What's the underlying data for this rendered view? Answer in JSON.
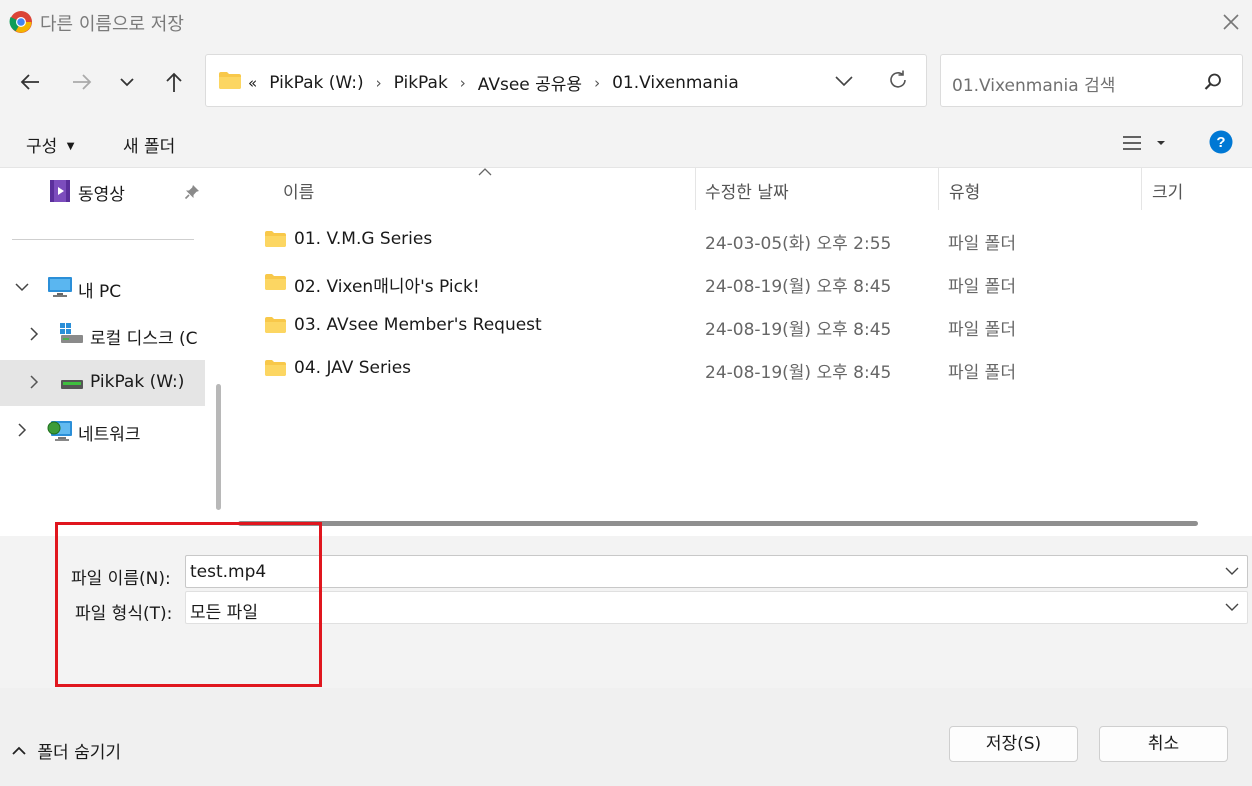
{
  "window": {
    "title": "다른 이름으로 저장",
    "close_icon": "close-icon"
  },
  "address": {
    "overflow": "«",
    "crumbs": [
      "PikPak (W:)",
      "PikPak",
      "AVsee 공유용",
      "01.Vixenmania"
    ]
  },
  "search": {
    "placeholder": "01.Vixenmania 검색"
  },
  "toolbar": {
    "organize": "구성",
    "new_folder": "새 폴더"
  },
  "sidebar": {
    "quick": {
      "label": "동영상"
    },
    "this_pc": {
      "label": "내 PC"
    },
    "local_disk": {
      "label": "로컬 디스크 (C"
    },
    "pikpak": {
      "label": "PikPak (W:)"
    },
    "network": {
      "label": "네트워크"
    }
  },
  "columns": {
    "name": "이름",
    "date": "수정한 날짜",
    "type": "유형",
    "size": "크기"
  },
  "files": [
    {
      "name": "01. V.M.G Series",
      "date": "24-03-05(화) 오후 2:55",
      "type": "파일 폴더"
    },
    {
      "name": "02. Vixen매니아's Pick!",
      "date": "24-08-19(월) 오후 8:45",
      "type": "파일 폴더"
    },
    {
      "name": "03. AVsee Member's Request",
      "date": "24-08-19(월) 오후 8:45",
      "type": "파일 폴더"
    },
    {
      "name": "04. JAV Series",
      "date": "24-08-19(월) 오후 8:45",
      "type": "파일 폴더"
    }
  ],
  "form": {
    "filename_label": "파일 이름(N):",
    "filename_value": "test.mp4",
    "filetype_label": "파일 형식(T):",
    "filetype_value": "모든 파일"
  },
  "footer": {
    "hide_folders": "폴더 숨기기",
    "save": "저장(S)",
    "cancel": "취소"
  },
  "colors": {
    "highlight_box": "#e0161e",
    "selected_nav": "#e5e5e5",
    "help_blue": "#0078d4",
    "folder_yellow": "#f8c84a"
  }
}
